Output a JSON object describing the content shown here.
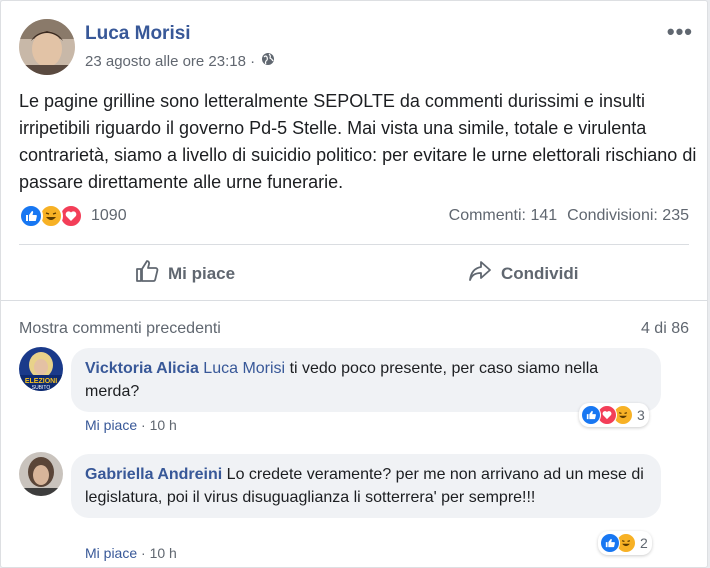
{
  "post": {
    "author": "Luca Morisi",
    "timestamp": "23 agosto alle ore 23:18 ·",
    "privacy_icon": "globe-icon",
    "text": "Le pagine grilline sono letteralmente SEPOLTE da commenti durissimi e insulti irripetibili riguardo il governo Pd-5 Stelle. Mai vista una simile, totale e virulenta contrarietà, siamo a livello di suicidio politico: per evitare le urne elettorali rischiano di passare direttamente alle urne funerarie.",
    "reaction_count": "1090",
    "comments_stat": "Commenti: 141",
    "shares_stat": "Condivisioni: 235",
    "like_label": "Mi piace",
    "share_label": "Condividi"
  },
  "comments_section": {
    "previous_label": "Mostra commenti precedenti",
    "count_label": "4 di 86",
    "comments": [
      {
        "author": "Vicktoria Alicia",
        "tag": "Luca Morisi",
        "text": "ti vedo poco presente, per caso siamo nella merda?",
        "like_label": "Mi piace",
        "time": "· 10 h",
        "reaction_count": "3",
        "avatar_text": "ELEZIONI",
        "avatar_subtext": "SUBITO"
      },
      {
        "author": "Gabriella Andreini",
        "text": "Lo credete veramente? per me non arrivano ad un mese di legislatura, poi il virus disuguaglianza li sotterrera' per sempre!!!",
        "like_label": "Mi piace",
        "time": "· 10 h",
        "reaction_count": "2"
      }
    ]
  },
  "colors": {
    "link": "#385898",
    "like_blue": "#1877f2",
    "love_red": "#f33e58",
    "haha_yellow": "#f7b125"
  }
}
